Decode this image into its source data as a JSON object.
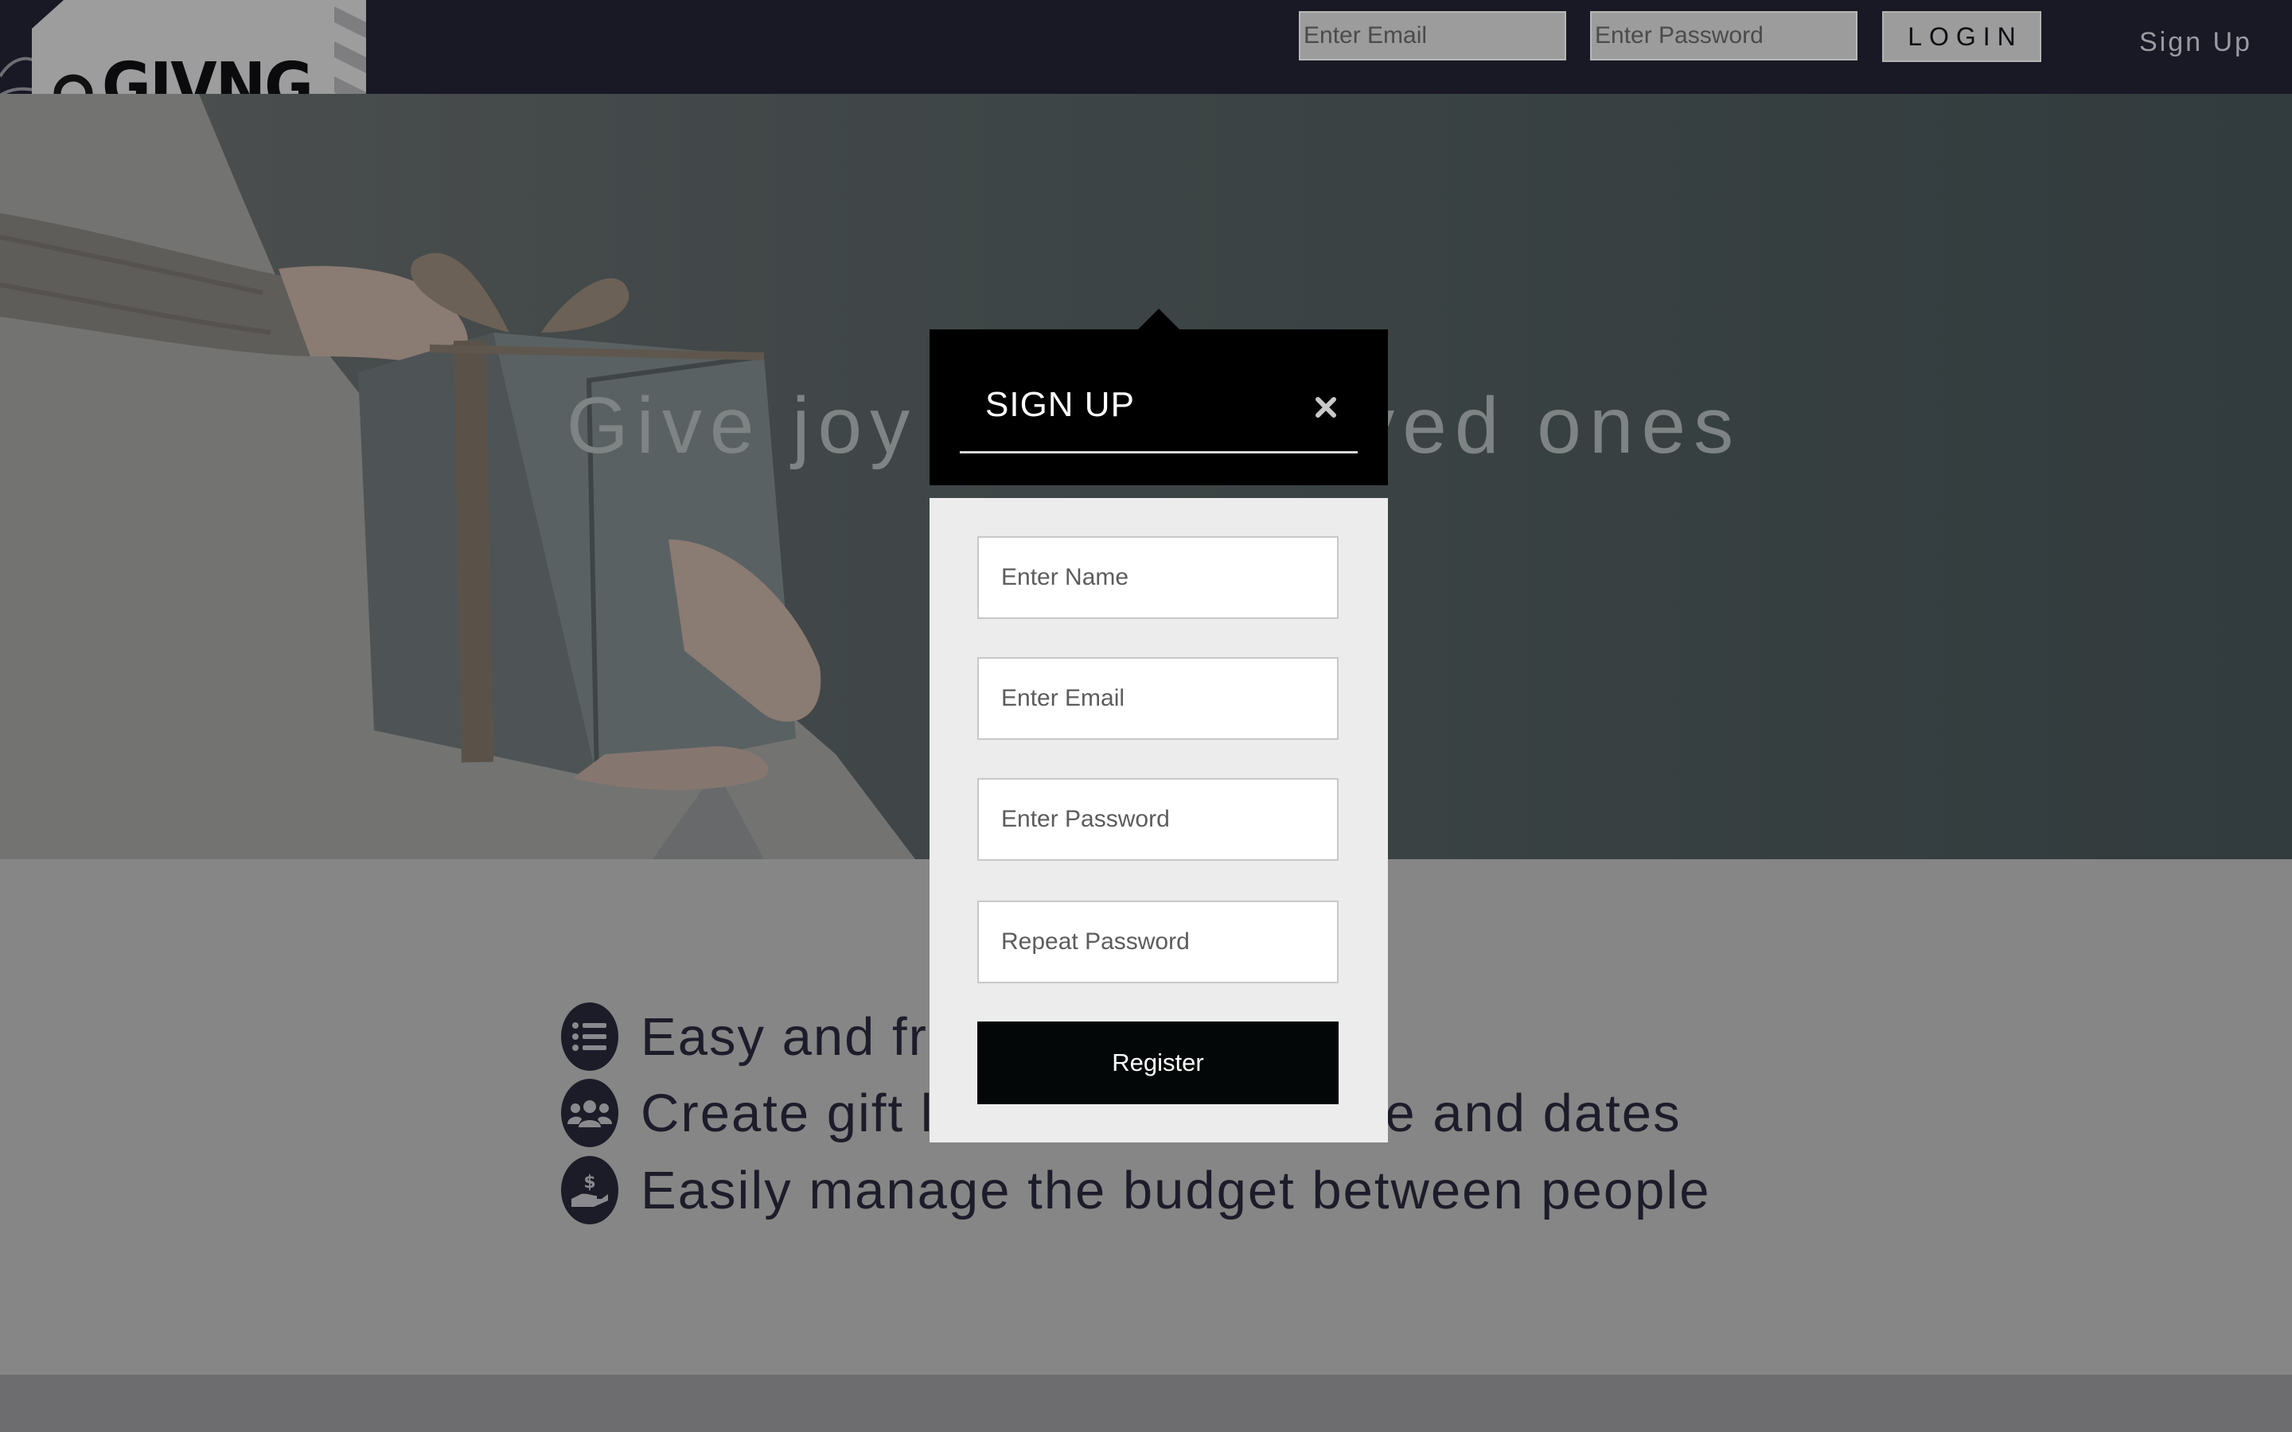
{
  "brand": {
    "logo_text": "GIVNG"
  },
  "header": {
    "email_placeholder": "Enter Email",
    "password_placeholder": "Enter Password",
    "login_label": "LOGIN",
    "signup_label": "Sign Up"
  },
  "hero": {
    "title": "Give joy to your loved ones"
  },
  "features": [
    {
      "icon": "list-icon",
      "text": "Easy and free to use"
    },
    {
      "icon": "users-icon",
      "text": "Create gift lists for your people and dates"
    },
    {
      "icon": "money-hand-icon",
      "text": "Easily manage the budget between people"
    }
  ],
  "modal": {
    "title": "SIGN UP",
    "close_icon": "close-icon",
    "name_placeholder": "Enter Name",
    "email_placeholder": "Enter Email",
    "password_placeholder": "Enter Password",
    "repeat_password_placeholder": "Repeat Password",
    "register_label": "Register"
  },
  "colors": {
    "topbar": "#181925",
    "modal_header": "#000000",
    "modal_body": "#ececec",
    "register_button": "#040708",
    "feature_icon": "#1c1c28"
  }
}
